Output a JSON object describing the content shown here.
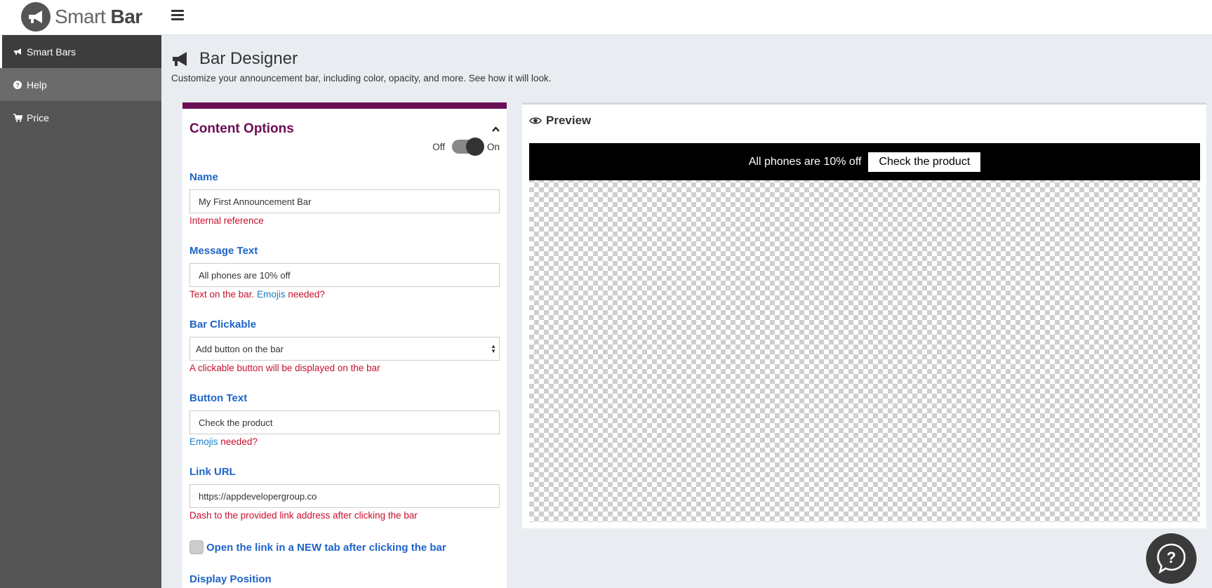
{
  "app": {
    "logo_light": "Smart",
    "logo_bold": "Bar"
  },
  "sidebar": {
    "items": [
      {
        "label": "Smart Bars",
        "icon": "megaphone-icon"
      },
      {
        "label": "Help",
        "icon": "question-circle-icon"
      },
      {
        "label": "Price",
        "icon": "cart-icon"
      }
    ]
  },
  "header": {
    "title": "Bar Designer",
    "subtitle": "Customize your announcement bar, including color, opacity, and more. See how it will look."
  },
  "content_options": {
    "title": "Content Options",
    "toggle_off": "Off",
    "toggle_on": "On",
    "name": {
      "label": "Name",
      "value": "My First Announcement Bar",
      "help": "Internal reference"
    },
    "message": {
      "label": "Message Text",
      "value": "All phones are 10% off",
      "help_prefix": "Text on the bar.",
      "help_link": "Emojis",
      "help_suffix": "needed?"
    },
    "clickable": {
      "label": "Bar Clickable",
      "value": "Add button on the bar",
      "help": "A clickable button will be displayed on the bar"
    },
    "button_text": {
      "label": "Button Text",
      "value": "Check the product",
      "help_link": "Emojis",
      "help_suffix": "needed?"
    },
    "link_url": {
      "label": "Link URL",
      "value": "https://appdevelopergroup.co",
      "help": "Dash to the provided link address after clicking the bar"
    },
    "new_tab": {
      "label": "Open the link in a NEW tab after clicking the bar"
    },
    "display_position": {
      "label": "Display Position"
    }
  },
  "preview": {
    "title": "Preview",
    "bar_message": "All phones are 10% off",
    "bar_button": "Check the product"
  },
  "colors": {
    "accent": "#6b0d56",
    "label_blue": "#1f64c8",
    "help_red": "#c8102e",
    "sidebar": "#555555"
  }
}
